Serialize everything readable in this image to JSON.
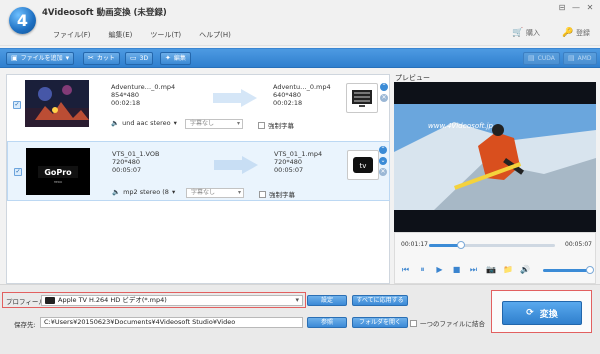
{
  "app": {
    "title": "4Videosoft 動画変換 (未登録)",
    "logo_text": "4"
  },
  "menu": [
    "ファイル(F)",
    "編集(E)",
    "ツール(T)",
    "ヘルプ(H)"
  ],
  "window_controls": [
    "⊟",
    "—",
    "✕"
  ],
  "top_actions": {
    "buy": "購入",
    "register": "登録"
  },
  "toolbar": {
    "add_file": "ファイルを追加",
    "cut": "カット",
    "three_d": "3D",
    "edit": "編集",
    "cuda": "CUDA",
    "amd": "AMD"
  },
  "files": [
    {
      "src_name": "Adventure…_0.mp4",
      "src_res": "854*480",
      "src_dur": "00:02:18",
      "dst_name": "Adventu…_0.mp4",
      "dst_res": "640*480",
      "dst_dur": "00:02:18",
      "audio": "und aac stereo",
      "subtitle": "字幕なし",
      "forced": "強制字幕",
      "device_icon": "tv-device-icon"
    },
    {
      "src_name": "VTS_01_1.VOB",
      "src_res": "720*480",
      "src_dur": "00:05:07",
      "dst_name": "VTS_01_1.mp4",
      "dst_res": "720*480",
      "dst_dur": "00:05:07",
      "audio": "mp2 stereo (8",
      "subtitle": "字幕なし",
      "forced": "強制字幕",
      "device_icon": "appletv-icon"
    }
  ],
  "preview": {
    "label": "プレビュー",
    "watermark": "www.4Videosoft.jp",
    "time_current": "00:01:17",
    "time_total": "00:05:07",
    "progress": 0.25,
    "volume": 1.0
  },
  "bottom": {
    "profile_label": "プロフィール:",
    "profile_value": "Apple TV H.264 HD ビデオ(*.mp4)",
    "settings": "設定",
    "apply_all": "すべてに応用する",
    "dest_label": "保存先:",
    "dest_path": "C:¥Users¥20150623¥Documents¥4Videosoft Studio¥Video",
    "browse": "参照",
    "open_folder": "フォルダを開く",
    "merge": "一つのファイルに結合",
    "convert": "変換"
  },
  "colors": {
    "accent": "#2f7fce",
    "highlight_border": "#e26060"
  }
}
